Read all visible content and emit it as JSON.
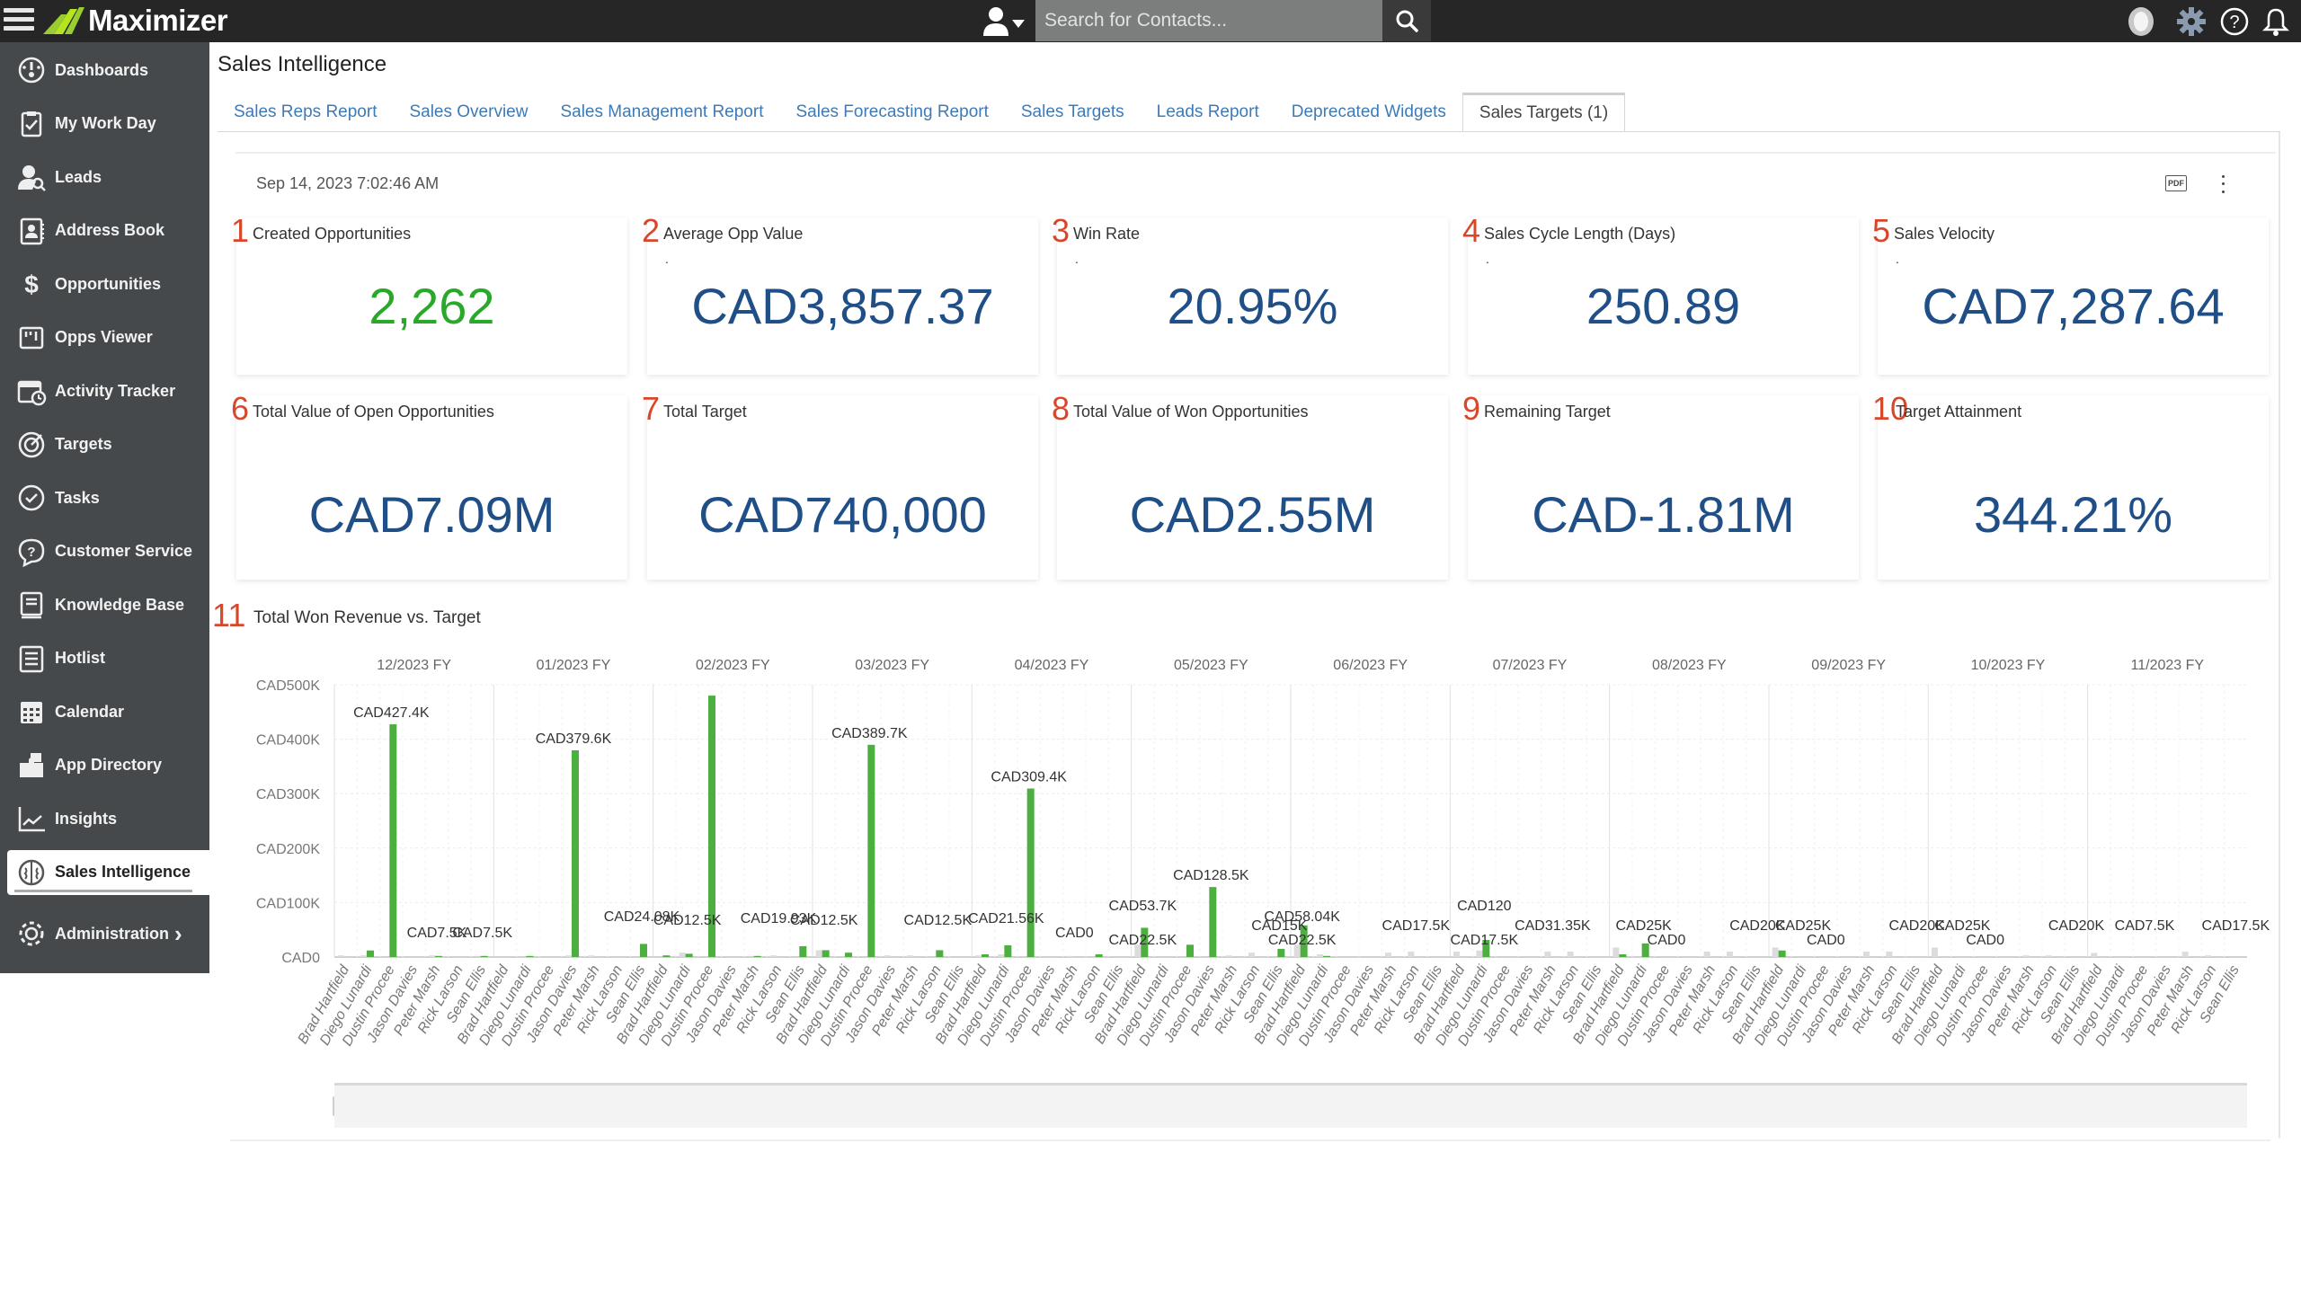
{
  "app": {
    "name": "Maximizer",
    "search_placeholder": "Search for Contacts..."
  },
  "topbar": {
    "icons": [
      "menu-icon",
      "contact-type-dropdown-icon",
      "search-icon",
      "avatar-icon",
      "gear-icon",
      "help-icon",
      "bell-icon"
    ]
  },
  "sidebar": {
    "items": [
      {
        "label": "Dashboards",
        "icon": "dashboard-gauge-icon"
      },
      {
        "label": "My Work Day",
        "icon": "clipboard-check-icon"
      },
      {
        "label": "Leads",
        "icon": "user-search-icon"
      },
      {
        "label": "Address Book",
        "icon": "address-book-icon"
      },
      {
        "label": "Opportunities",
        "icon": "dollar-icon"
      },
      {
        "label": "Opps Viewer",
        "icon": "kanban-icon"
      },
      {
        "label": "Activity Tracker",
        "icon": "calendar-clock-icon"
      },
      {
        "label": "Targets",
        "icon": "target-icon"
      },
      {
        "label": "Tasks",
        "icon": "check-circle-icon"
      },
      {
        "label": "Customer Service",
        "icon": "question-bubble-icon"
      },
      {
        "label": "Knowledge Base",
        "icon": "book-icon"
      },
      {
        "label": "Hotlist",
        "icon": "list-icon"
      },
      {
        "label": "Calendar",
        "icon": "calendar-icon"
      },
      {
        "label": "App Directory",
        "icon": "puzzle-icon"
      },
      {
        "label": "Insights",
        "icon": "line-chart-icon"
      },
      {
        "label": "Sales Intelligence",
        "icon": "brain-icon",
        "active": true
      },
      {
        "label": "Administration",
        "icon": "cog-icon",
        "chevron": "›"
      }
    ]
  },
  "page": {
    "title": "Sales Intelligence",
    "tabs": [
      {
        "label": "Sales Reps Report"
      },
      {
        "label": "Sales Overview"
      },
      {
        "label": "Sales Management Report"
      },
      {
        "label": "Sales Forecasting Report"
      },
      {
        "label": "Sales Targets"
      },
      {
        "label": "Leads Report"
      },
      {
        "label": "Deprecated Widgets"
      },
      {
        "label": "Sales Targets (1)",
        "active": true
      }
    ],
    "report_date": "Sep 14, 2023 7:02:46 AM",
    "pdf_label": "PDF"
  },
  "kpis": [
    {
      "num": "1",
      "title": "Created Opportunities",
      "value": "2,262",
      "color": "#2aa82a",
      "dot": ""
    },
    {
      "num": "2",
      "title": "Average Opp Value",
      "value": "CAD3,857.37",
      "dot": "."
    },
    {
      "num": "3",
      "title": "Win Rate",
      "value": "20.95%",
      "dot": "."
    },
    {
      "num": "4",
      "title": "Sales Cycle Length (Days)",
      "value": "250.89",
      "dot": "."
    },
    {
      "num": "5",
      "title": "Sales Velocity",
      "value": "CAD7,287.64",
      "dot": "."
    },
    {
      "num": "6",
      "title": "Total Value of Open Opportunities",
      "value": "CAD7.09M"
    },
    {
      "num": "7",
      "title": "Total Target",
      "value": "CAD740,000"
    },
    {
      "num": "8",
      "title": "Total Value of Won Opportunities",
      "value": "CAD2.55M"
    },
    {
      "num": "9",
      "title": "Remaining Target",
      "value": "CAD-1.81M"
    },
    {
      "num": "10",
      "title": "Target Attainment",
      "value": "344.21%"
    }
  ],
  "colors": {
    "won_bar": "#4caf3f",
    "target_bar": "#dcdcdc",
    "kpi_value": "#1f4f86",
    "kpi_number": "#d9472b",
    "tab_link": "#3d7ab8"
  },
  "chart_data": {
    "type": "bar",
    "number": "11",
    "title": "Total Won Revenue vs. Target",
    "ylabel": "",
    "xlabel": "",
    "ylim": [
      0,
      500000
    ],
    "yticks": [
      "CAD0",
      "CAD100K",
      "CAD200K",
      "CAD300K",
      "CAD400K",
      "CAD500K"
    ],
    "ytick_values": [
      0,
      100000,
      200000,
      300000,
      400000,
      500000
    ],
    "grid": true,
    "legend": "none",
    "groups": [
      "12/2023 FY",
      "01/2023 FY",
      "02/2023 FY",
      "03/2023 FY",
      "04/2023 FY",
      "05/2023 FY",
      "06/2023 FY",
      "07/2023 FY",
      "08/2023 FY",
      "09/2023 FY",
      "10/2023 FY",
      "11/2023 FY"
    ],
    "categories": [
      "Brad Hartfield",
      "Diego Lunardi",
      "Dustin Procee",
      "Jason Davies",
      "Peter Marsh",
      "Rick Larson",
      "Sean Ellis"
    ],
    "series": [
      {
        "name": "Won Revenue",
        "values": [
          [
            0,
            12000,
            427400,
            0,
            2000,
            0,
            2000
          ],
          [
            0,
            2000,
            0,
            379600,
            0,
            0,
            24080
          ],
          [
            3000,
            6000,
            480000,
            0,
            2000,
            0,
            19930
          ],
          [
            12500,
            8000,
            389700,
            0,
            0,
            12500,
            0
          ],
          [
            5000,
            21560,
            309400,
            0,
            0,
            5000,
            0
          ],
          [
            53700,
            0,
            22500,
            128500,
            0,
            0,
            15000
          ],
          [
            58040,
            2000,
            0,
            0,
            0,
            0,
            0
          ],
          [
            0,
            31350,
            0,
            0,
            0,
            0,
            0
          ],
          [
            5000,
            25000,
            0,
            0,
            0,
            0,
            0
          ],
          [
            12000,
            0,
            0,
            0,
            0,
            0,
            0
          ],
          [
            0,
            0,
            0,
            0,
            0,
            0,
            0
          ],
          [
            0,
            0,
            0,
            0,
            0,
            0,
            0
          ]
        ]
      },
      {
        "name": "Target",
        "values": [
          [
            3000,
            3000,
            0,
            0,
            3000,
            0,
            0
          ],
          [
            0,
            0,
            0,
            3000,
            3000,
            0,
            0
          ],
          [
            0,
            8000,
            0,
            0,
            0,
            3000,
            0
          ],
          [
            12500,
            0,
            0,
            3000,
            3000,
            0,
            0
          ],
          [
            3000,
            5000,
            0,
            0,
            2000,
            0,
            0
          ],
          [
            22500,
            0,
            0,
            0,
            3000,
            8000,
            0
          ],
          [
            22500,
            5000,
            0,
            0,
            8000,
            10000,
            0
          ],
          [
            10000,
            12000,
            0,
            0,
            10000,
            10000,
            0
          ],
          [
            17500,
            0,
            0,
            0,
            10000,
            10000,
            0
          ],
          [
            17500,
            0,
            0,
            0,
            10000,
            10000,
            0
          ],
          [
            17500,
            0,
            0,
            0,
            3000,
            3000,
            0
          ],
          [
            7500,
            0,
            0,
            0,
            10000,
            3000,
            0
          ]
        ]
      }
    ],
    "data_labels": [
      [
        "CAD427.4K",
        "CAD7.5K",
        "CAD7.5K"
      ],
      [
        "CAD379.6K",
        "CAD24.08K"
      ],
      [
        "CAD12.5K",
        "CAD19.93K"
      ],
      [
        "CAD12.5K",
        "CAD389.7K",
        "CAD12.5K"
      ],
      [
        "CAD21.56K",
        "CAD309.4K",
        "CAD0"
      ],
      [
        "CAD22.5K",
        "CAD53.7K",
        "CAD128.5K",
        "CAD15K"
      ],
      [
        "CAD22.5K",
        "CAD58.04K",
        "CAD17.5K"
      ],
      [
        "CAD17.5K",
        "CAD120",
        "CAD31.35K",
        "CAD17.5K"
      ],
      [
        "CAD25K",
        "CAD0",
        "CAD20K"
      ],
      [
        "CAD25K",
        "CAD0",
        "CAD20K"
      ],
      [
        "CAD25K",
        "CAD0",
        "CAD20K"
      ],
      [
        "CAD7.5K",
        "CAD17.5K"
      ]
    ]
  }
}
